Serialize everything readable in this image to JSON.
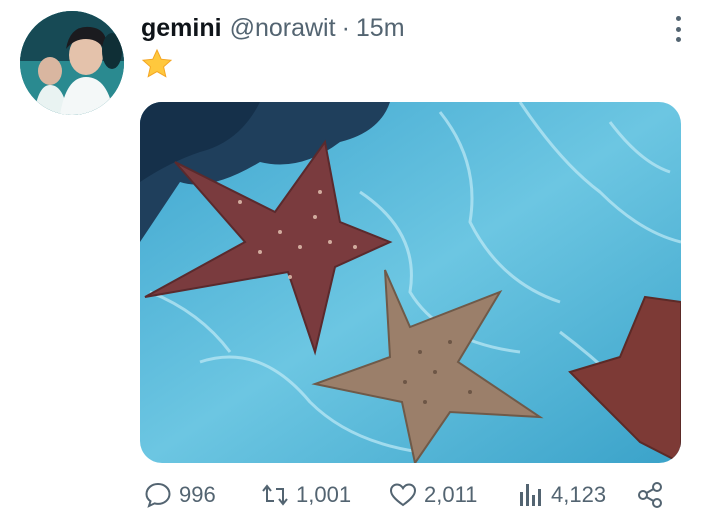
{
  "tweet": {
    "display_name": "gemini",
    "handle": "@norawit",
    "separator": "·",
    "time": "15m",
    "text_emoji": "star-emoji",
    "media": {
      "description_icon": "starfish-photo"
    },
    "actions": {
      "reply_count": "996",
      "retweet_count": "1,001",
      "like_count": "2,011",
      "views_count": "4,123"
    }
  },
  "colors": {
    "text_primary": "#0f1419",
    "text_secondary": "#536471",
    "star": "#ffc83d",
    "water": "#4fb8d6"
  }
}
